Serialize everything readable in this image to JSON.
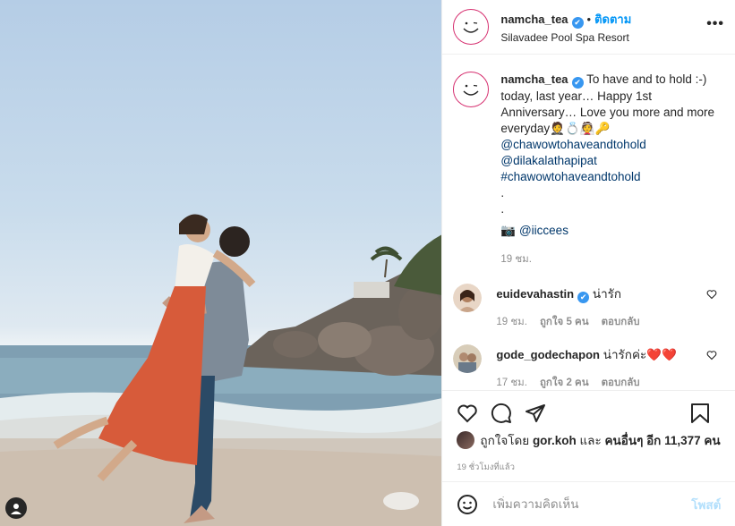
{
  "post": {
    "username": "namcha_tea",
    "verified_mark": "✔",
    "dot": "•",
    "follow_label": "ติดตาม",
    "location": "Silavadee Pool Spa Resort",
    "more_label": "•••"
  },
  "caption": {
    "username": "namcha_tea",
    "text": "To have and to hold :-) today, last year… Happy 1st Anniversary… Love you more and more everyday🤵💍👰🔑",
    "mention1": "@chawowtohaveandtohold",
    "mention2": "@dilakalathapipat",
    "hashtag": "#chawowtohaveandtohold",
    "dot1": ".",
    "dot2": ".",
    "camera": "📷",
    "credit": "@iiccees",
    "time": "19 ชม."
  },
  "comments": [
    {
      "username": "euidevahastin",
      "verified": true,
      "text": "น่ารัก",
      "time": "19 ชม.",
      "likes": "ถูกใจ 5 คน",
      "reply": "ตอบกลับ"
    },
    {
      "username": "gode_godechapon",
      "verified": false,
      "text": "น่ารักค่ะ❤️❤️",
      "time": "17 ชม.",
      "likes": "ถูกใจ 2 คน",
      "reply": "ตอบกลับ"
    }
  ],
  "likes": {
    "prefix": "ถูกใจโดย",
    "user": "gor.koh",
    "middle": "และ",
    "others": "คนอื่นๆ อีก 11,377 คน"
  },
  "timestamp": "19 ชั่วโมงที่แล้ว",
  "add_comment": {
    "placeholder": "เพิ่มความคิดเห็น",
    "post_label": "โพสต์"
  },
  "colors": {
    "link": "#00376b",
    "follow": "#0095f6",
    "verified": "#3897f0",
    "post_disabled": "#b2dffc"
  }
}
